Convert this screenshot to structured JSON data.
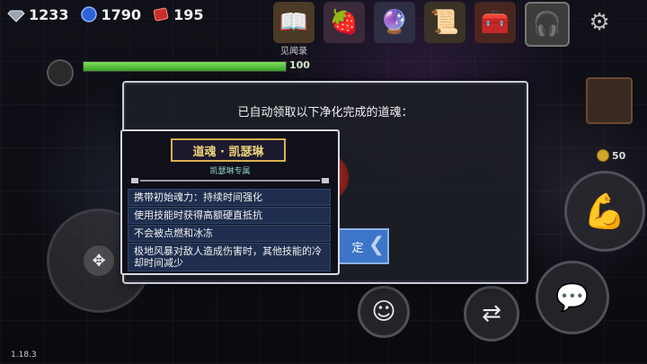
{
  "resources": [
    {
      "icon": "gem-icon",
      "value": "1233"
    },
    {
      "icon": "blue-crystal-icon",
      "value": "1790"
    },
    {
      "icon": "red-ticket-icon",
      "value": "195"
    }
  ],
  "top_menu": [
    {
      "name": "journal",
      "icon": "book-icon",
      "label": "见闻录"
    },
    {
      "name": "pets",
      "icon": "fruit-basket-icon",
      "label": ""
    },
    {
      "name": "weapon",
      "icon": "staff-icon",
      "label": ""
    },
    {
      "name": "scroll",
      "icon": "scroll-icon",
      "label": ""
    },
    {
      "name": "chest",
      "icon": "chest-icon",
      "label": ""
    },
    {
      "name": "customer-service",
      "icon": "headset-icon",
      "label": ""
    },
    {
      "name": "settings",
      "icon": "gear-icon",
      "label": ""
    }
  ],
  "player": {
    "health": 100,
    "health_max": 100,
    "health_text": "100"
  },
  "dialog": {
    "title": "已自动领取以下净化完成的道魂：",
    "confirm_label": "确定",
    "confirm_visible_fragment": "定"
  },
  "soul_card": {
    "name": "道魂 · 凯瑟琳",
    "subtitle": "凯瑟琳专属",
    "traits": [
      "携带初始魂力：持续时间强化",
      "使用技能时获得高额硬直抵抗",
      "不会被点燃和冰冻",
      "极地风暴对敌人造成伤害时，其他技能的冷却时间减少"
    ]
  },
  "side": {
    "coin_value": "50"
  },
  "version": "1.18.3",
  "colors": {
    "accent_blue": "#3d76c8",
    "gold": "#d7b14a",
    "trait_bg": "#1f2e4e",
    "hp_green": "#5bc93e"
  }
}
